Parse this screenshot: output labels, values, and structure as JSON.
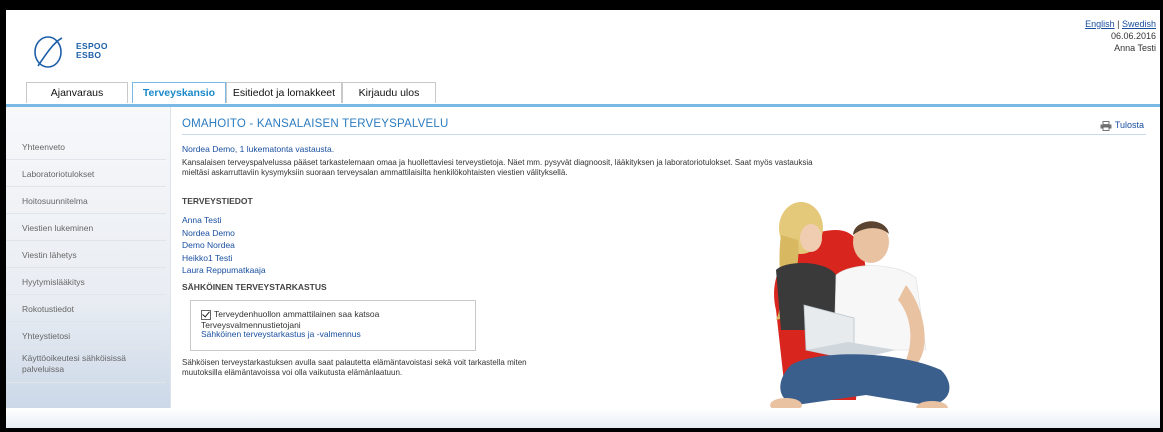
{
  "header": {
    "logo_line1": "ESPOO",
    "logo_line2": "ESBO",
    "lang_english": "English",
    "lang_sep": "|",
    "lang_swedish": "Swedish",
    "date": "06.06.2016",
    "user": "Anna Testi"
  },
  "tabs": [
    {
      "label": "Ajanvaraus"
    },
    {
      "label": "Terveyskansio"
    },
    {
      "label": "Esitiedot ja lomakkeet"
    },
    {
      "label": "Kirjaudu ulos"
    }
  ],
  "sidebar": {
    "items": [
      {
        "label": "Yhteenveto"
      },
      {
        "label": "Laboratoriotulokset"
      },
      {
        "label": "Hoitosuunnitelma"
      },
      {
        "label": "Viestien lukeminen"
      },
      {
        "label": "Viestin lähetys"
      },
      {
        "label": "Hyytymislääkitys"
      },
      {
        "label": "Rokotustiedot"
      },
      {
        "label": "Yhteystietosi"
      },
      {
        "label": "Käyttöoikeutesi sähköisissä palveluissa"
      }
    ]
  },
  "main": {
    "title": "OMAHOITO - KANSALAISEN TERVEYSPALVELU",
    "print_label": "Tulosta",
    "notice": "Nordea Demo, 1 lukematonta vastausta.",
    "intro_line1": "Kansalaisen terveyspalvelussa pääset tarkastelemaan omaa ja huollettaviesi terveystietoja. Näet mm. pysyvät diagnoosit, lääkityksen ja laboratoriotulokset. Saat myös vastauksia",
    "intro_line2": "mieltäsi askarruttaviin kysymyksiin suoraan terveysalan ammattilaisilta henkilökohtaisten viestien välityksellä.",
    "health_heading": "TERVEYSTIEDOT",
    "people": [
      "Anna Testi",
      "Nordea Demo",
      "Demo Nordea",
      "Heikko1 Testi",
      "Laura Reppumatkaaja"
    ],
    "checkup_heading": "SÄHKÖINEN TERVEYSTARKASTUS",
    "checkbox_label": "Terveydenhuollon ammattilainen saa katsoa Terveysvalmennustietojani",
    "checkup_link": "Sähköinen terveystarkastus ja -valmennus",
    "outro_line1": "Sähköisen terveystarkastuksen avulla saat palautetta elämäntavoistasi sekä voit tarkastella miten",
    "outro_line2": "muutoksilla elämäntavoissa voi olla vaikutusta elämänlaatuun."
  },
  "colors": {
    "accent": "#1a88c9",
    "link": "#1a4fa0",
    "title": "#2b7bbf"
  }
}
